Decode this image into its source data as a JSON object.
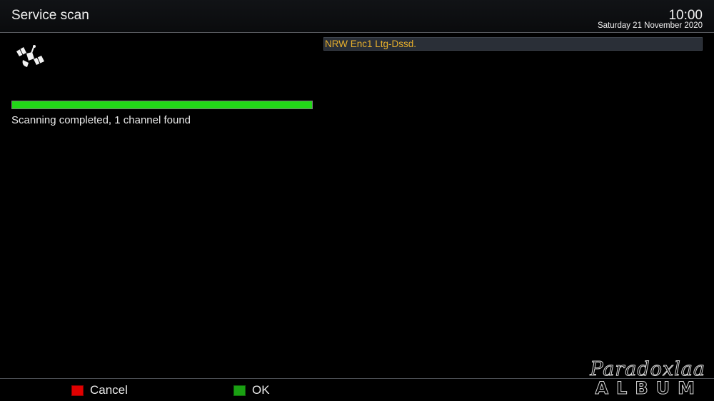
{
  "header": {
    "title": "Service scan",
    "time": "10:00",
    "date": "Saturday 21 November 2020"
  },
  "scan": {
    "progress_percent": 100,
    "status_text": "Scanning completed, 1 channel found",
    "icon": "satellite-icon"
  },
  "channels": [
    {
      "name": "NRW Enc1 Ltg-Dssd."
    }
  ],
  "footer": {
    "buttons": [
      {
        "label": "Cancel",
        "color": "#e00000"
      },
      {
        "label": "OK",
        "color": "#1aa012"
      }
    ]
  },
  "watermark": {
    "script_text": "Paradoxlaa",
    "block_text": "ALBUM"
  },
  "colors": {
    "progress_fill": "#22d918",
    "channel_text": "#e8b02c",
    "selection_bg": "#2a2f37"
  }
}
